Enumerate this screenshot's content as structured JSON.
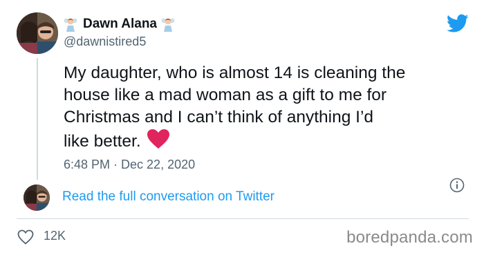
{
  "tweet": {
    "display_name": "Dawn Alana",
    "handle": "@dawnistired5",
    "text": "My daughter, who is almost 14 is cleaning the\nhouse like a mad woman as a gift to me for\nChristmas and I can’t think of anything I’d\nlike better.",
    "timestamp": "6:48 PM · Dec 22, 2020",
    "read_link": "Read the full conversation on Twitter",
    "likes": "12K"
  },
  "icons": {
    "brand": "twitter-bird-icon",
    "emoji_name": "fairy-emoji",
    "heart": "red-heart-emoji",
    "info": "info-icon",
    "like": "heart-outline-icon"
  },
  "watermark": "boredpanda.com",
  "colors": {
    "twitter_blue": "#1d9bf0",
    "secondary_text": "#536471",
    "heart_red": "#e0245e"
  }
}
